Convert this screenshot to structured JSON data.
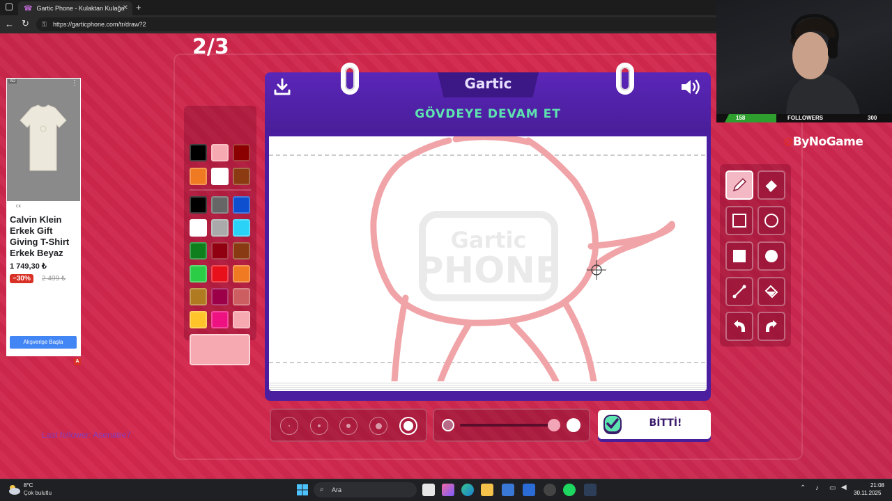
{
  "browser": {
    "tab_title": "Gartic Phone - Kulaktan Kulağa",
    "url": "https://garticphone.com/tr/draw?2"
  },
  "game": {
    "round": "2/3",
    "logo": "Gartic",
    "instruction": "GÖVDEYE DEVAM ET",
    "done_label": "BİTTİ!",
    "canvas_watermark": [
      "Gartic",
      "PHONE"
    ],
    "palette": [
      [
        "#000000",
        "#f6a9b1",
        "#8b0000"
      ],
      [
        "#f07a22",
        "#ffffff",
        "#8b3a12"
      ],
      [
        "#000000",
        "#666666",
        "#0d4fcf"
      ],
      [
        "#ffffff",
        "#aaaaaa",
        "#2ad2f7"
      ],
      [
        "#0f7f1e",
        "#900010",
        "#8a3a12"
      ],
      [
        "#2bcc46",
        "#e8101a",
        "#f07a22"
      ],
      [
        "#b07a20",
        "#9c0048",
        "#cc5d61"
      ],
      [
        "#fec42a",
        "#ee1181",
        "#f6a9b1"
      ]
    ],
    "current_color": "#f6a9b1",
    "tools": [
      "pencil",
      "eraser",
      "rectangle-outline",
      "ellipse-outline",
      "rectangle-filled",
      "ellipse-filled",
      "line",
      "fill-bucket",
      "undo",
      "redo"
    ],
    "active_tool": "pencil",
    "brush_sizes": 5,
    "active_brush_size": 5,
    "opacity_percent": 100
  },
  "ad": {
    "label": "AD",
    "brand": "CK",
    "title": "Calvin Klein Erkek Gift Giving T-Shirt Erkek Beyaz",
    "price": "1 749,30 ₺",
    "discount": "−30%",
    "old_price": "2 499 ₺",
    "cta": "Alışverişe Başla",
    "badge": "A"
  },
  "overlay": {
    "followers_count": "158",
    "followers_label": "FOLLOWERS",
    "followers_goal": "300",
    "followers_progress": 0.53,
    "sponsor": "ByNoGame",
    "last_follower": "Last follower: Asenatre7"
  },
  "taskbar": {
    "weather_temp": "8°C",
    "weather_desc": "Çok bulutlu",
    "search_placeholder": "Ara",
    "time": "21:08",
    "date": "30.11.2025"
  }
}
